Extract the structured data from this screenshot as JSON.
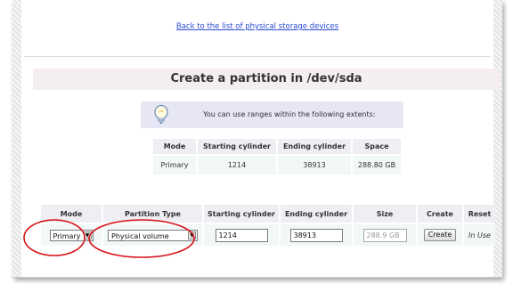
{
  "back_link": "Back to the list of physical storage devices",
  "title": "Create a partition in /dev/sda",
  "info": "You can use ranges within the following extents:",
  "extents": {
    "headers": [
      "Mode",
      "Starting cylinder",
      "Ending cylinder",
      "Space"
    ],
    "row": [
      "Primary",
      "1214",
      "38913",
      "288.80 GB"
    ]
  },
  "create_form": {
    "headers": [
      "Mode",
      "Partition Type",
      "Starting cylinder",
      "Ending cylinder",
      "Size",
      "Create",
      "Reset"
    ],
    "mode_value": "Primary",
    "partition_type_value": "Physical volume",
    "start_value": "1214",
    "end_value": "38913",
    "size_value": "288.9 GB",
    "create_label": "Create",
    "reset_label": "In Use"
  },
  "colors": {
    "link": "#2a4bd7",
    "annotation": "#d8141a",
    "title_bg": "#f5eeee",
    "info_bg": "#e6e6f4"
  },
  "icons": [
    "lightbulb-icon",
    "dropdown-arrow-icon"
  ]
}
